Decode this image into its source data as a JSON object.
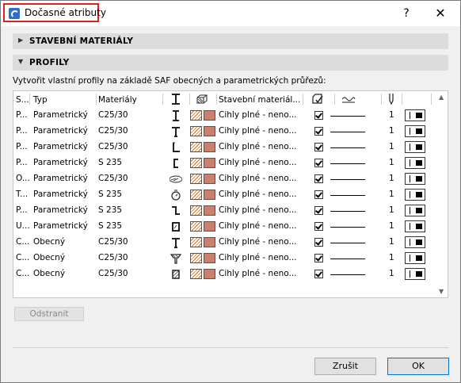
{
  "window": {
    "title": "Dočasné atributy",
    "help_label": "?",
    "close_label": "✕"
  },
  "sections": {
    "materials": {
      "label": "STAVEBNÍ MATERIÁLY",
      "expanded": false
    },
    "profiles": {
      "label": "PROFILY",
      "expanded": true
    }
  },
  "description": "Vytvořit vlastní profily na základě SAF obecných a parametrických průřezů:",
  "table": {
    "headers": {
      "s": "S...",
      "type": "Typ",
      "materials": "Materiály",
      "building_material": "Stavební materiál..."
    },
    "header_icons": [
      "profile-column-icon",
      "cut-fill-column-icon",
      "override-column-icon",
      "line-type-column-icon",
      "pen-column-icon",
      "visibility-column-icon"
    ],
    "rows": [
      {
        "s": "P...",
        "type": "Parametrický",
        "material": "C25/30",
        "icon": "i-beam",
        "building_material": "Cihly plné - neno...",
        "pen": "1"
      },
      {
        "s": "P...",
        "type": "Parametrický",
        "material": "C25/30",
        "icon": "t-beam",
        "building_material": "Cihly plné - neno...",
        "pen": "1"
      },
      {
        "s": "P...",
        "type": "Parametrický",
        "material": "C25/30",
        "icon": "l-section",
        "building_material": "Cihly plné - neno...",
        "pen": "1"
      },
      {
        "s": "P...",
        "type": "Parametrický",
        "material": "S 235",
        "icon": "c-channel",
        "building_material": "Cihly plné - neno...",
        "pen": "1"
      },
      {
        "s": "O...",
        "type": "Parametrický",
        "material": "C25/30",
        "icon": "oval",
        "building_material": "Cihly plné - neno...",
        "pen": "1"
      },
      {
        "s": "T...",
        "type": "Parametrický",
        "material": "S 235",
        "icon": "circle",
        "building_material": "Cihly plné - neno...",
        "pen": "1"
      },
      {
        "s": "P...",
        "type": "Parametrický",
        "material": "S 235",
        "icon": "z-section",
        "building_material": "Cihly plné - neno...",
        "pen": "1"
      },
      {
        "s": "U...",
        "type": "Parametrický",
        "material": "S 235",
        "icon": "rect-tube",
        "building_material": "Cihly plné - neno...",
        "pen": "1"
      },
      {
        "s": "C...",
        "type": "Obecný",
        "material": "C25/30",
        "icon": "t-beam",
        "building_material": "Cihly plné - neno...",
        "pen": "1"
      },
      {
        "s": "C...",
        "type": "Obecný",
        "material": "C25/30",
        "icon": "t-taper",
        "building_material": "Cihly plné - neno...",
        "pen": "1"
      },
      {
        "s": "C...",
        "type": "Obecný",
        "material": "C25/30",
        "icon": "hatched-block",
        "building_material": "Cihly plné - neno...",
        "pen": "1"
      }
    ]
  },
  "buttons": {
    "remove": "Odstranit",
    "cancel": "Zrušit",
    "ok": "OK"
  },
  "colors": {
    "title_highlight": "#e02020",
    "swatch": "#c98070",
    "ok_border": "#0078d7"
  }
}
